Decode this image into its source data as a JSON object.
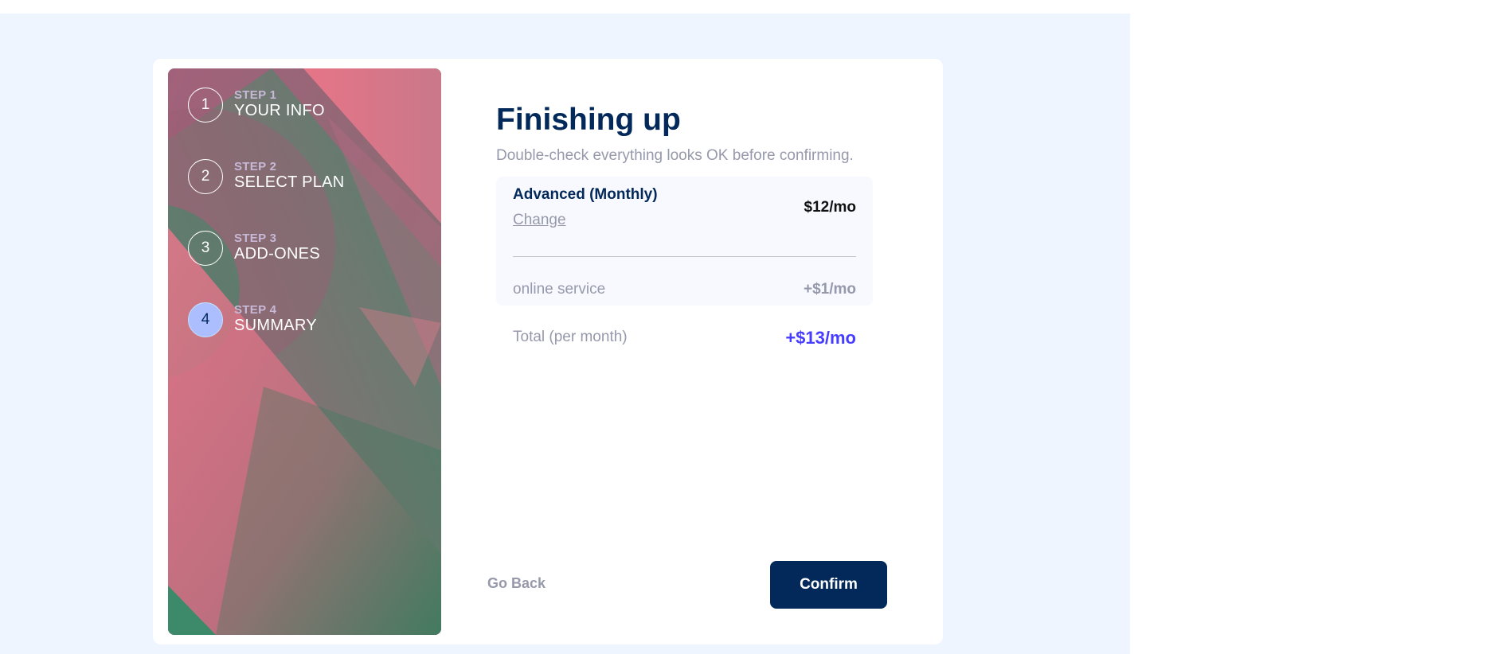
{
  "steps": [
    {
      "number": "1",
      "step_label": "STEP 1",
      "name": "YOUR INFO",
      "active": false
    },
    {
      "number": "2",
      "step_label": "STEP 2",
      "name": "SELECT PLAN",
      "active": false
    },
    {
      "number": "3",
      "step_label": "STEP 3",
      "name": "ADD-ONES",
      "active": false
    },
    {
      "number": "4",
      "step_label": "STEP 4",
      "name": "SUMMARY",
      "active": true
    }
  ],
  "main": {
    "title": "Finishing up",
    "subtitle": "Double-check everything looks OK before confirming."
  },
  "summary": {
    "plan_name": "Advanced (Monthly)",
    "change_label": "Change",
    "plan_price": "$12/mo",
    "addons": [
      {
        "name": "online service",
        "price": "+$1/mo"
      }
    ],
    "total_label": "Total (per month)",
    "total_price": "+$13/mo"
  },
  "actions": {
    "back_label": "Go Back",
    "confirm_label": "Confirm"
  },
  "colors": {
    "page_background": "#eef5ff",
    "primary_navy": "#02295a",
    "accent_purple": "#473dff",
    "muted_gray": "#9699ab",
    "active_step": "#adbeff"
  }
}
